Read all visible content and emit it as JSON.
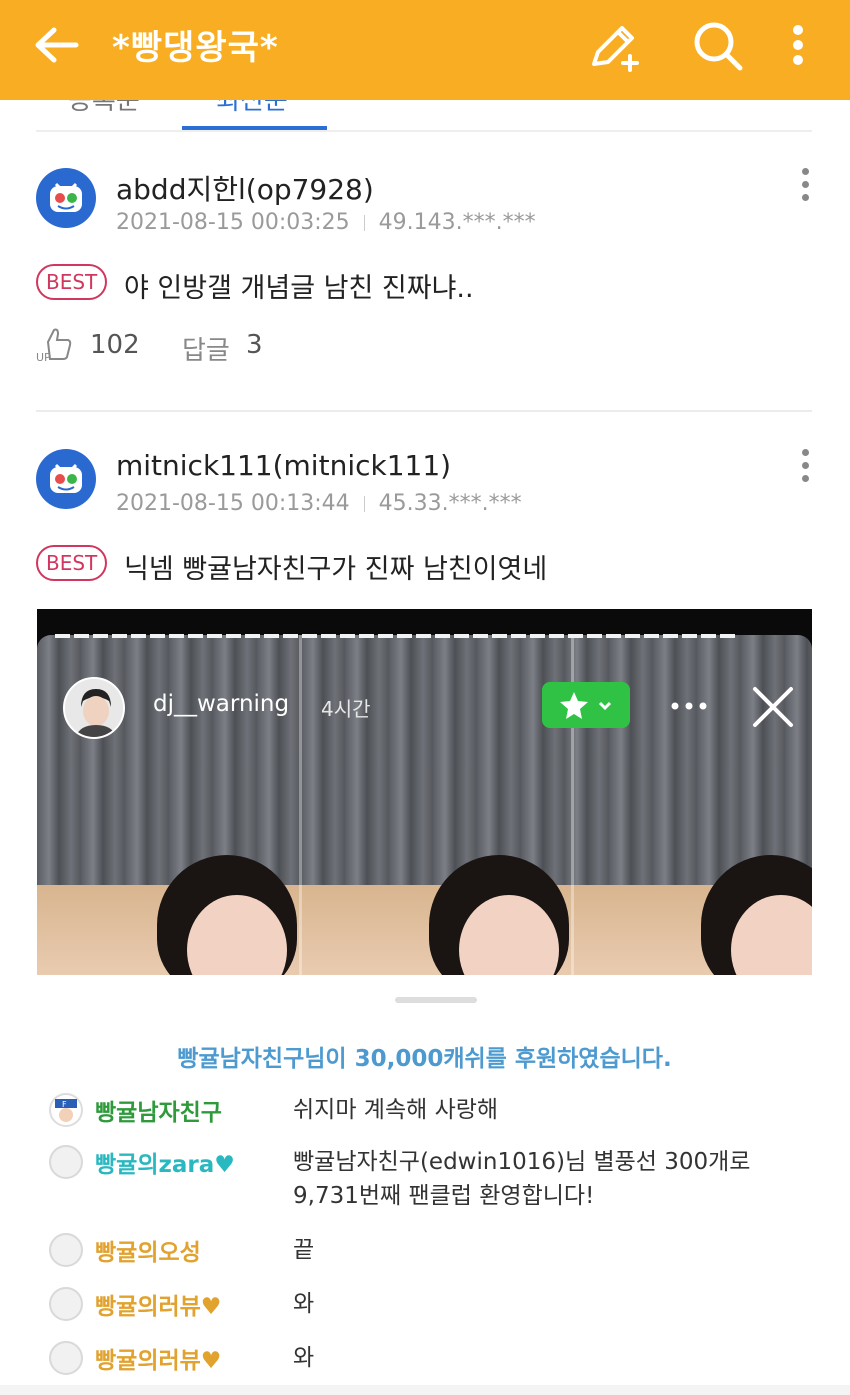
{
  "appbar": {
    "title": "*빵댕왕국*",
    "color": "#f8ad22",
    "icons": [
      "back-arrow-icon",
      "write-icon",
      "search-icon",
      "more-vertical-icon"
    ]
  },
  "tabs": {
    "items": [
      "등록순",
      "최신순"
    ],
    "active_index": 1
  },
  "comments": [
    {
      "username": "abdd지한l(op7928)",
      "datetime": "2021-08-15 00:03:25",
      "ip": "49.143.***.***",
      "badge": "BEST",
      "text": "야 인방갤 개념글 남친 진짜냐..",
      "likes": "102",
      "reply_label": "답글",
      "reply_count": "3"
    },
    {
      "username": "mitnick111(mitnick111)",
      "datetime": "2021-08-15 00:13:44",
      "ip": "45.33.***.***",
      "badge": "BEST",
      "text": "닉넴 빵귤남자친구가 진짜 남친이엿네"
    }
  ],
  "embedded": {
    "streamer": "dj__warning",
    "time_ago": "4시간",
    "donation_notice": "빵귤남자친구님이 30,000캐쉬를 후원하였습니다.",
    "chat": [
      {
        "nick": "빵귤남자친구",
        "msg": "쉬지마 계속해 사랑해",
        "color": "green"
      },
      {
        "nick": "빵귤의zara♥",
        "msg": "빵귤남자친구(edwin1016)님 별풍선 300개로",
        "msg2": "9,731번째 팬클럽 환영합니다!",
        "color": "teal"
      },
      {
        "nick": "빵귤의오성",
        "msg": "끝",
        "color": "gold"
      },
      {
        "nick": "빵귤의러뷰♥",
        "msg": "와",
        "color": "gold"
      },
      {
        "nick": "빵귤의러뷰♥",
        "msg": "와",
        "color": "gold"
      }
    ]
  }
}
